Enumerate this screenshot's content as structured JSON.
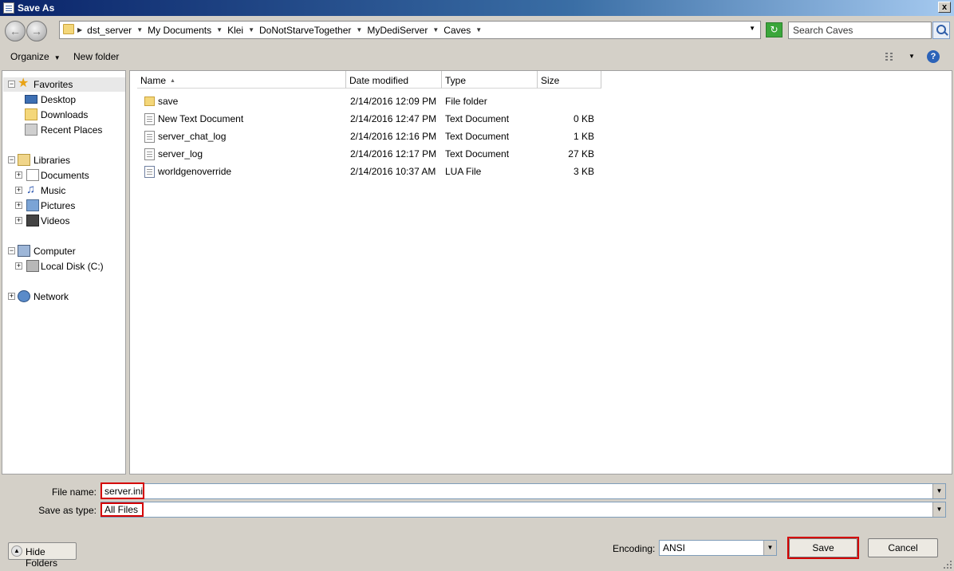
{
  "window": {
    "title": "Save As",
    "close_glyph": "x"
  },
  "address": {
    "crumbs": [
      "dst_server",
      "My Documents",
      "Klei",
      "DoNotStarveTogether",
      "MyDediServer",
      "Caves"
    ],
    "search_placeholder": "Search Caves"
  },
  "toolbar": {
    "organize_label": "Organize",
    "new_folder_label": "New folder"
  },
  "nav": {
    "favorites": {
      "label": "Favorites",
      "items": [
        "Desktop",
        "Downloads",
        "Recent Places"
      ]
    },
    "libraries": {
      "label": "Libraries",
      "items": [
        "Documents",
        "Music",
        "Pictures",
        "Videos"
      ]
    },
    "computer": {
      "label": "Computer",
      "items": [
        "Local Disk (C:)"
      ]
    },
    "network": {
      "label": "Network"
    }
  },
  "files": {
    "columns": [
      "Name",
      "Date modified",
      "Type",
      "Size"
    ],
    "rows": [
      {
        "name": "save",
        "date": "2/14/2016 12:09 PM",
        "type": "File folder",
        "size": "",
        "icon": "folder-icon"
      },
      {
        "name": "New Text Document",
        "date": "2/14/2016 12:47 PM",
        "type": "Text Document",
        "size": "0 KB",
        "icon": "text-file-icon"
      },
      {
        "name": "server_chat_log",
        "date": "2/14/2016 12:16 PM",
        "type": "Text Document",
        "size": "1 KB",
        "icon": "text-file-icon"
      },
      {
        "name": "server_log",
        "date": "2/14/2016 12:17 PM",
        "type": "Text Document",
        "size": "27 KB",
        "icon": "text-file-icon"
      },
      {
        "name": "worldgenoverride",
        "date": "2/14/2016 10:37 AM",
        "type": "LUA File",
        "size": "3 KB",
        "icon": "lua-file-icon"
      }
    ]
  },
  "form": {
    "file_name_label": "File name:",
    "file_name_value": "server.ini",
    "save_type_label": "Save as type:",
    "save_type_value": "All Files",
    "encoding_label": "Encoding:",
    "encoding_value": "ANSI"
  },
  "buttons": {
    "hide_folders": "Hide Folders",
    "save": "Save",
    "cancel": "Cancel"
  },
  "colors": {
    "highlight": "#d40000",
    "titlebar": "#0a246a"
  }
}
